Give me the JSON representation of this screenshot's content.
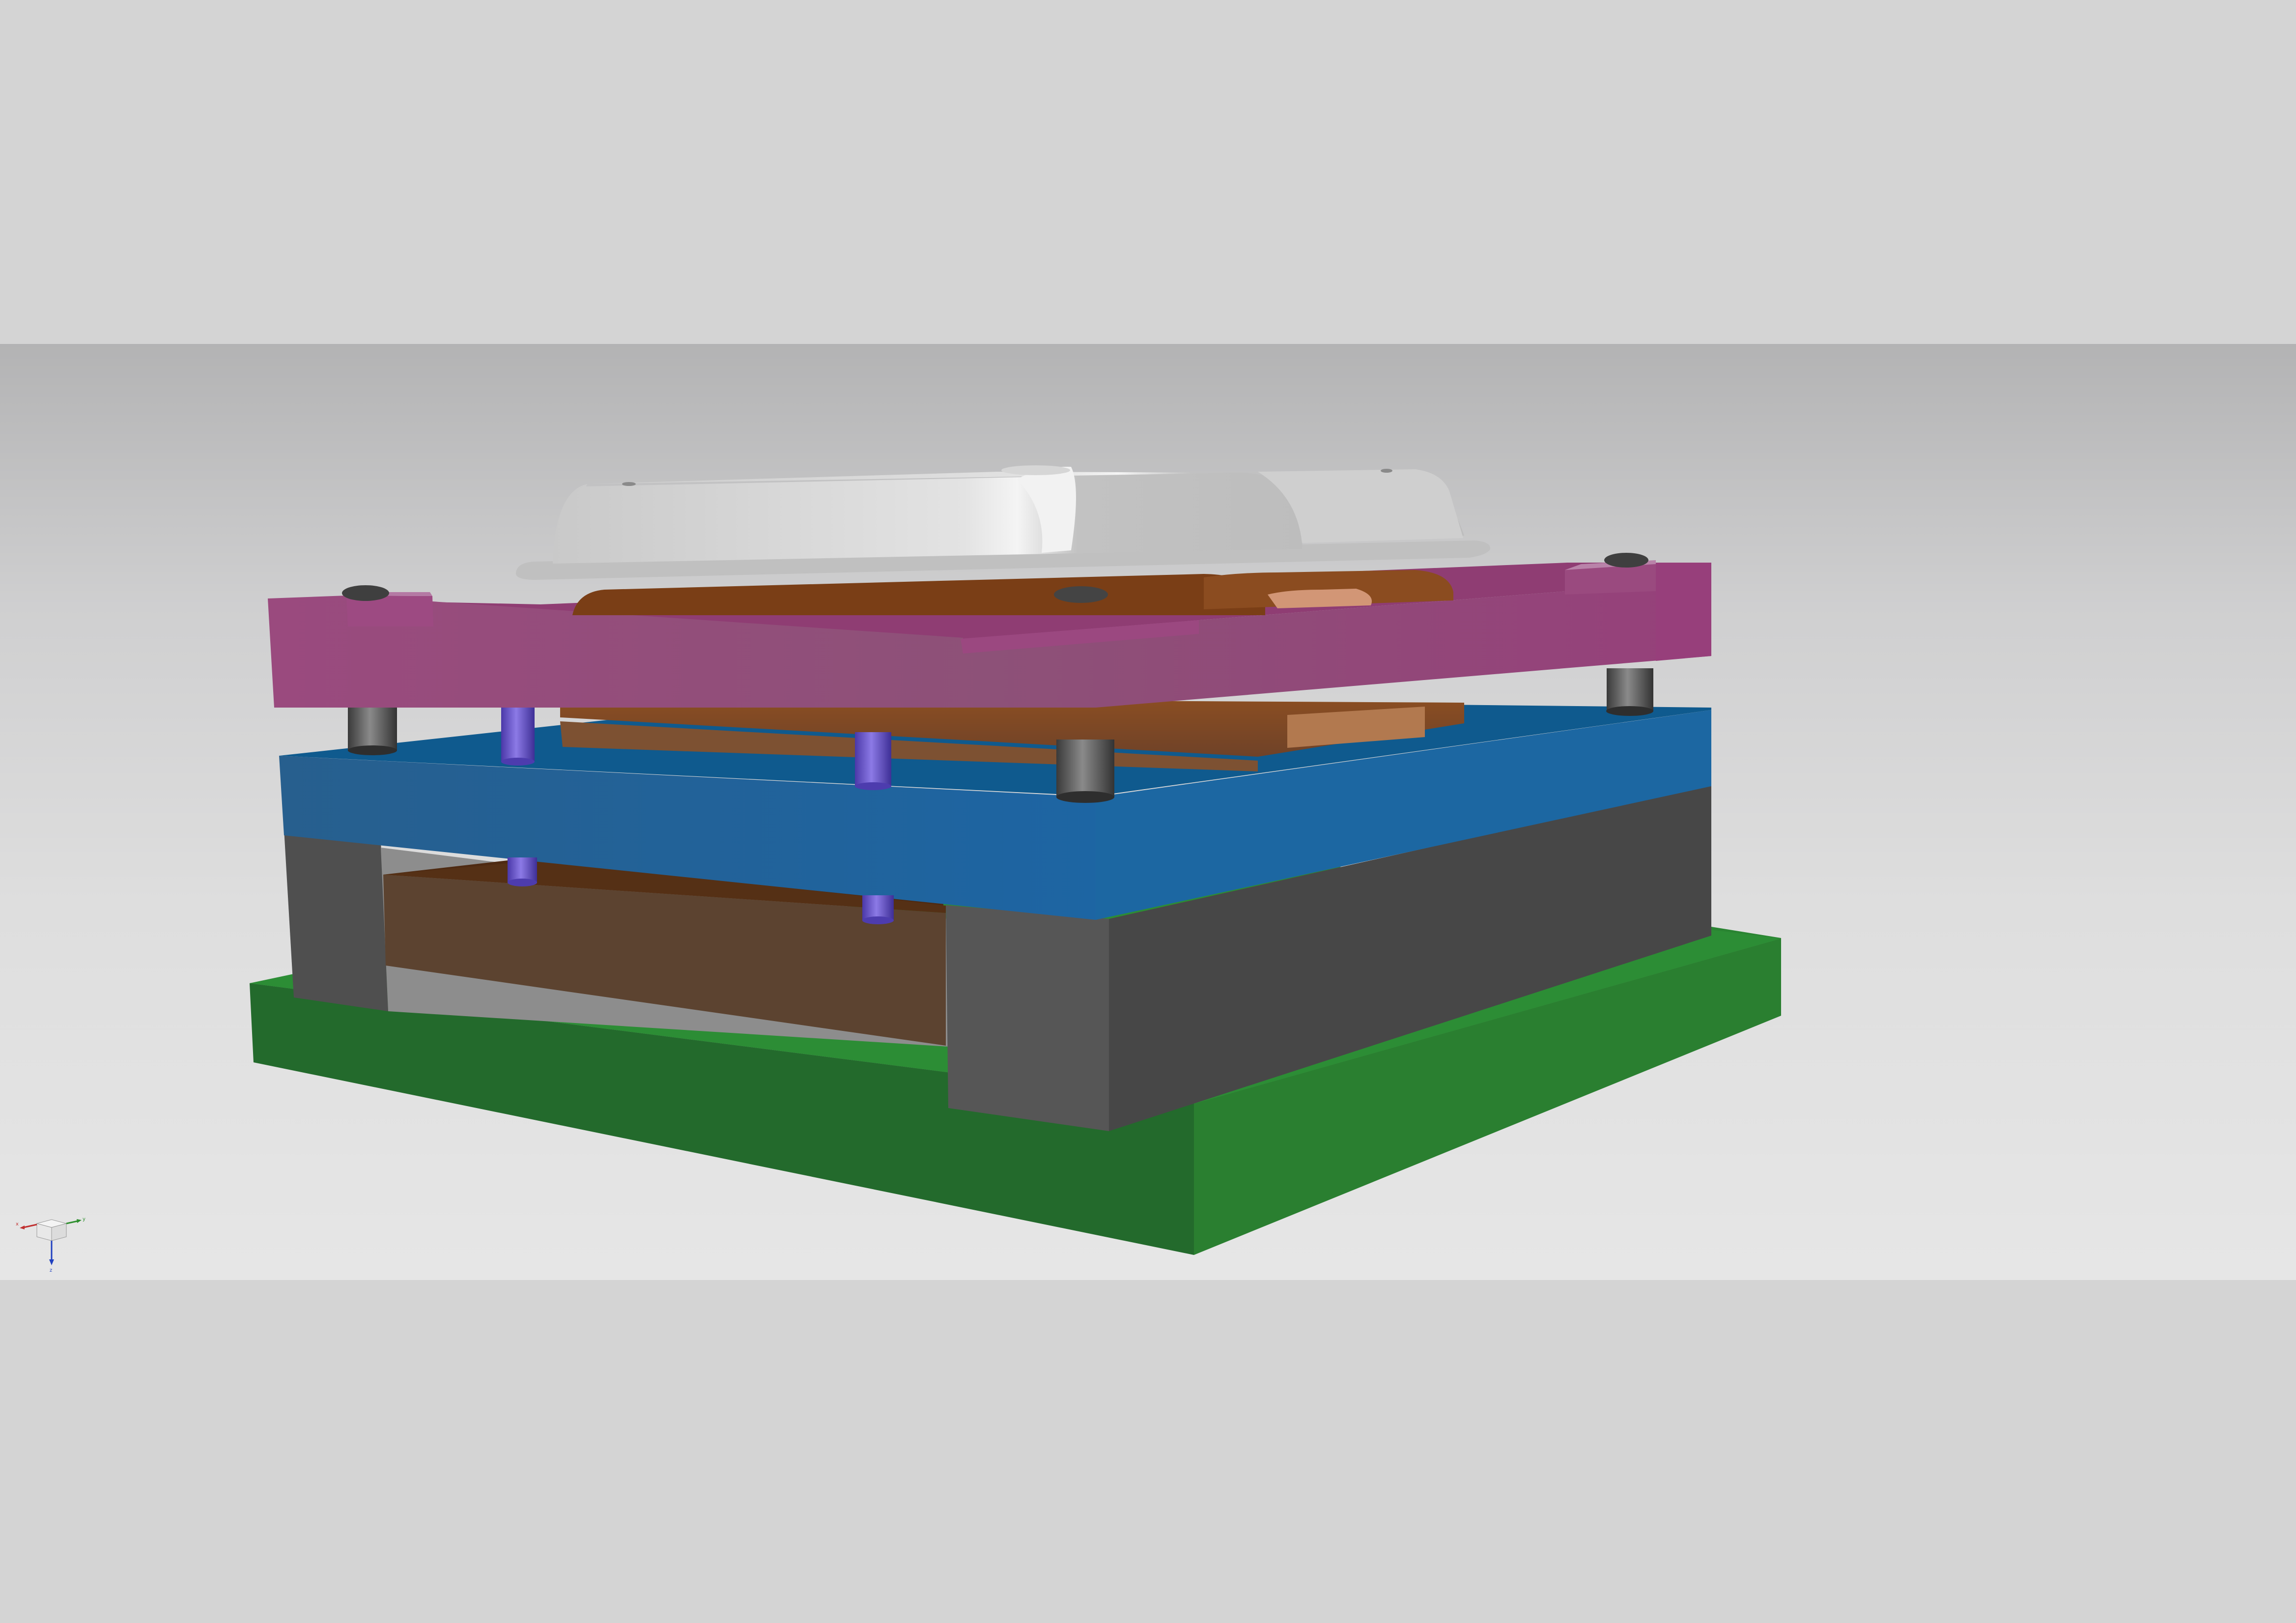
{
  "view": {
    "background_top": "#b3b3b4",
    "background_bottom": "#e6e6e6"
  },
  "assembly": {
    "parts": [
      {
        "name": "base-plate",
        "color": "#2a7f32"
      },
      {
        "name": "lower-die-block",
        "color": "#4b4b4b"
      },
      {
        "name": "lower-insert",
        "color": "#5c4330"
      },
      {
        "name": "middle-plate",
        "color": "#1e6497"
      },
      {
        "name": "upper-plate",
        "color": "#97457a"
      },
      {
        "name": "die-insert",
        "color": "#7d4d30"
      },
      {
        "name": "formed-part",
        "color": "#c8c8c8"
      },
      {
        "name": "guide-posts",
        "color": "#555555"
      },
      {
        "name": "pins",
        "color": "#5b48c2"
      }
    ]
  },
  "triad": {
    "x_label": "x",
    "y_label": "y",
    "z_label": "z",
    "x_color": "#c03030",
    "y_color": "#2f8f2f",
    "z_color": "#2040c0"
  }
}
